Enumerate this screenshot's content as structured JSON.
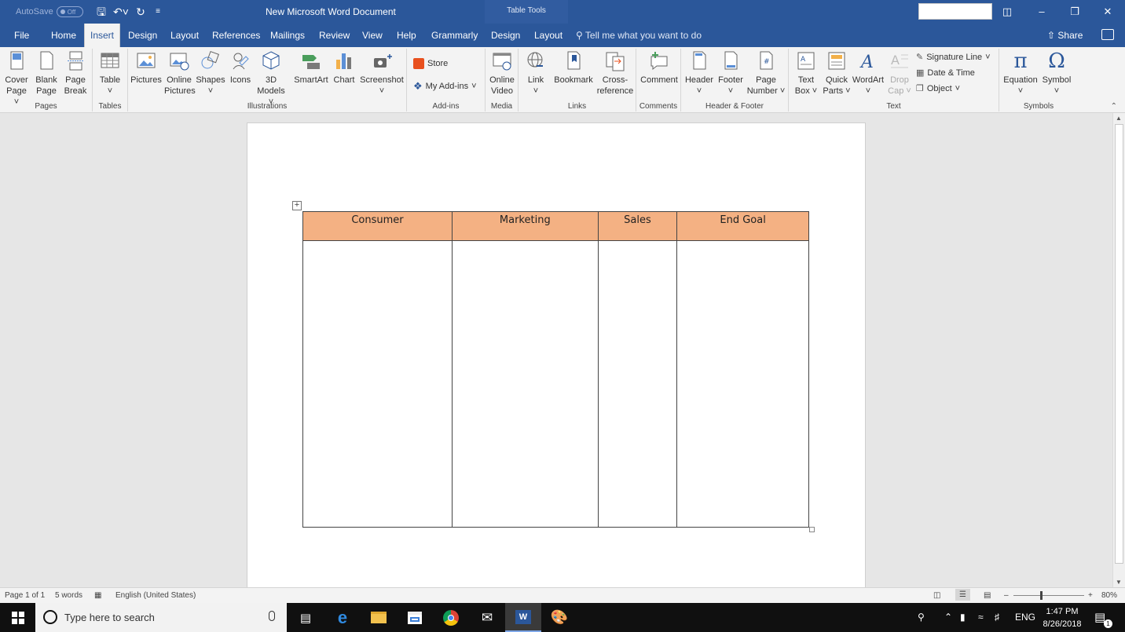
{
  "titlebar": {
    "autosave_label": "AutoSave",
    "autosave_state": "Off",
    "doc_title": "New Microsoft Word Document",
    "context_tools": "Table Tools"
  },
  "tabs": [
    {
      "label": "File"
    },
    {
      "label": "Home"
    },
    {
      "label": "Insert"
    },
    {
      "label": "Design"
    },
    {
      "label": "Layout"
    },
    {
      "label": "References"
    },
    {
      "label": "Mailings"
    },
    {
      "label": "Review"
    },
    {
      "label": "View"
    },
    {
      "label": "Help"
    },
    {
      "label": "Grammarly"
    },
    {
      "label": "Design"
    },
    {
      "label": "Layout"
    }
  ],
  "tellme": "Tell me what you want to do",
  "share_label": "Share",
  "ribbon": {
    "pages": {
      "label": "Pages",
      "cover_1": "Cover",
      "cover_2": "Page",
      "blank_1": "Blank",
      "blank_2": "Page",
      "break_1": "Page",
      "break_2": "Break"
    },
    "tables": {
      "label": "Tables",
      "table": "Table"
    },
    "illustrations": {
      "label": "Illustrations",
      "pictures": "Pictures",
      "online_1": "Online",
      "online_2": "Pictures",
      "shapes": "Shapes",
      "icons": "Icons",
      "models_1": "3D",
      "models_2": "Models",
      "smartart": "SmartArt",
      "chart": "Chart",
      "screenshot": "Screenshot"
    },
    "addins": {
      "label": "Add-ins",
      "store": "Store",
      "my_addins": "My Add-ins"
    },
    "media": {
      "label": "Media",
      "video_1": "Online",
      "video_2": "Video"
    },
    "links": {
      "label": "Links",
      "link": "Link",
      "bookmark": "Bookmark",
      "xref_1": "Cross-",
      "xref_2": "reference"
    },
    "comments": {
      "label": "Comments",
      "comment": "Comment"
    },
    "headerfooter": {
      "label": "Header & Footer",
      "header": "Header",
      "footer": "Footer",
      "pagenum_1": "Page",
      "pagenum_2": "Number"
    },
    "text": {
      "label": "Text",
      "textbox_1": "Text",
      "textbox_2": "Box",
      "quick_1": "Quick",
      "quick_2": "Parts",
      "wordart": "WordArt",
      "dropcap_1": "Drop",
      "dropcap_2": "Cap",
      "signature": "Signature Line",
      "datetime": "Date & Time",
      "object": "Object"
    },
    "symbols": {
      "label": "Symbols",
      "equation": "Equation",
      "symbol": "Symbol"
    }
  },
  "document": {
    "table_headers": [
      "Consumer",
      "Marketing",
      "Sales",
      "End Goal"
    ]
  },
  "statusbar": {
    "page": "Page 1 of 1",
    "words": "5 words",
    "language": "English (United States)",
    "zoom": "80%"
  },
  "taskbar": {
    "search_placeholder": "Type here to search",
    "lang": "ENG",
    "time": "1:47 PM",
    "date": "8/26/2018",
    "notif_count": "1"
  },
  "colors": {
    "word_blue": "#2b579a",
    "table_header_fill": "#f4b183"
  }
}
